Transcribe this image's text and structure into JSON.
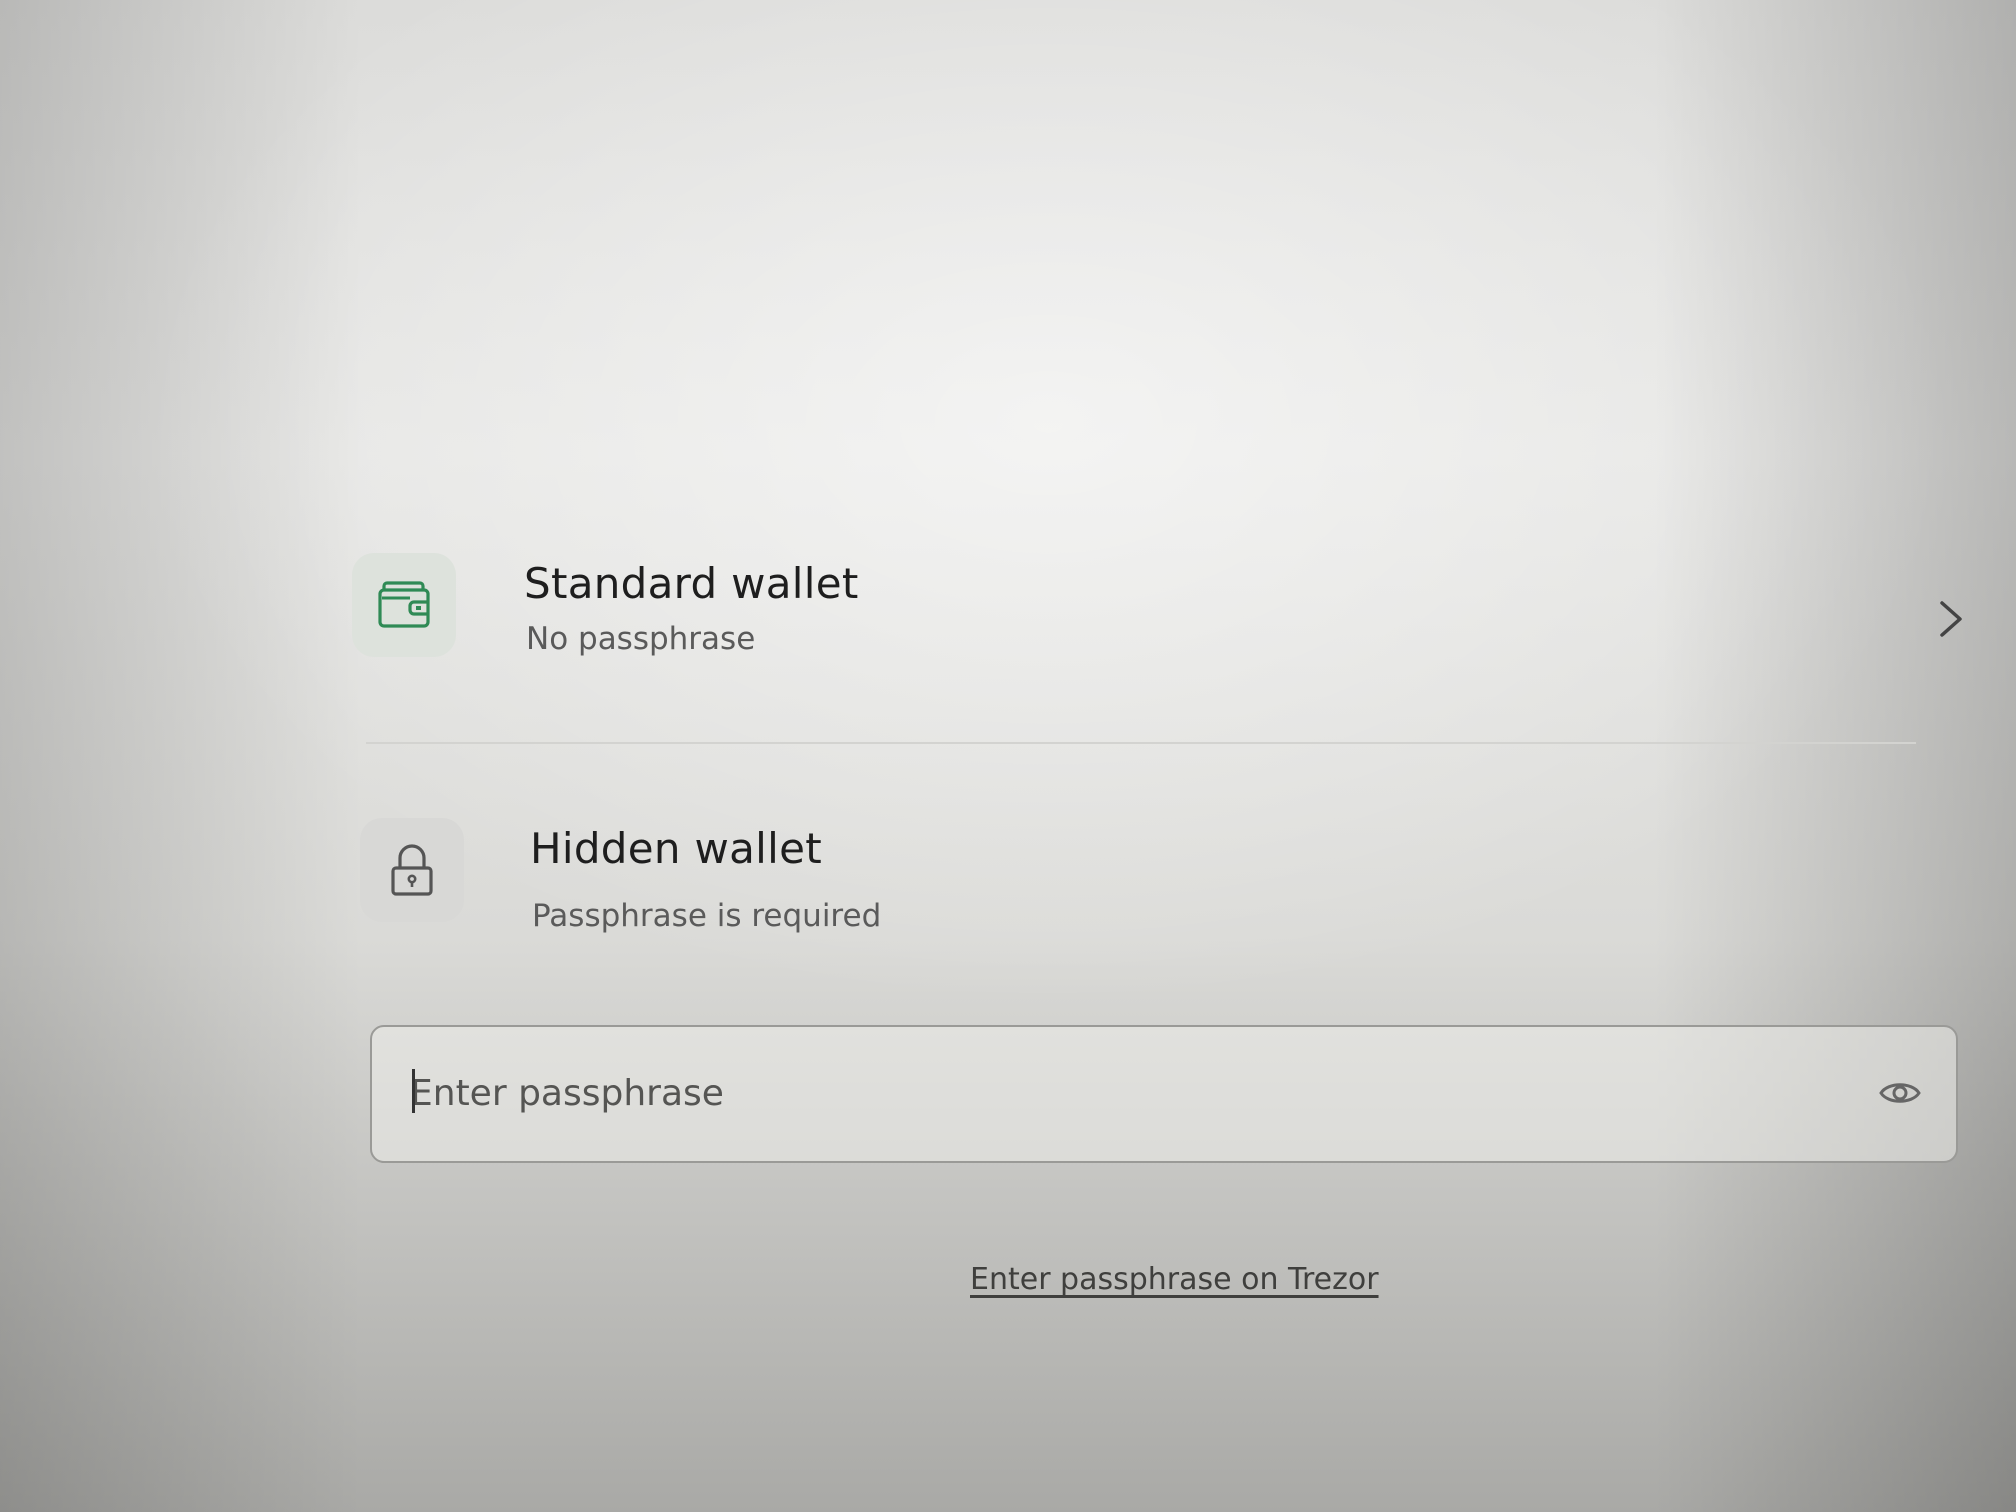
{
  "wallets": {
    "standard": {
      "title": "Standard wallet",
      "description": "No passphrase",
      "icon": "wallet-icon",
      "icon_color": "#2f8a55"
    },
    "hidden": {
      "title": "Hidden wallet",
      "description": "Passphrase is required",
      "icon": "lock-icon",
      "icon_color": "#555555"
    }
  },
  "passphrase": {
    "placeholder": "Enter passphrase",
    "value": "",
    "toggle_icon": "eye-icon"
  },
  "links": {
    "enter_on_device": "Enter passphrase on Trezor"
  },
  "colors": {
    "accent_green": "#2f8a55",
    "text_primary": "#1e1e1e",
    "text_secondary": "#5a5a5a"
  }
}
